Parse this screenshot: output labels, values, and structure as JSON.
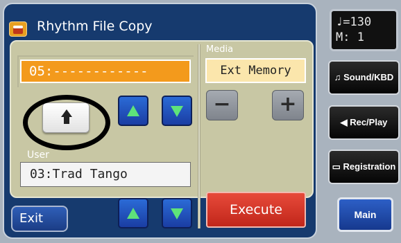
{
  "window": {
    "title": "Rhythm File Copy",
    "title_icon": "rhythm-drum-icon"
  },
  "source": {
    "value": "05:------------"
  },
  "user": {
    "label": "User",
    "value": "03:Trad Tango"
  },
  "media": {
    "label": "Media",
    "value": "Ext Memory",
    "minus_label": "−",
    "plus_label": "+"
  },
  "buttons": {
    "execute": "Execute",
    "exit": "Exit"
  },
  "display": {
    "tempo": "♩=130",
    "measure": "M:   1"
  },
  "side": {
    "sound": "Sound/KBD",
    "rec": "Rec/Play",
    "registration": "Registration",
    "main": "Main"
  },
  "colors": {
    "accent_orange": "#f39a1c",
    "execute_red": "#d5362a",
    "arrow_green": "#5ee37a",
    "panel_blue": "#163a6e"
  }
}
